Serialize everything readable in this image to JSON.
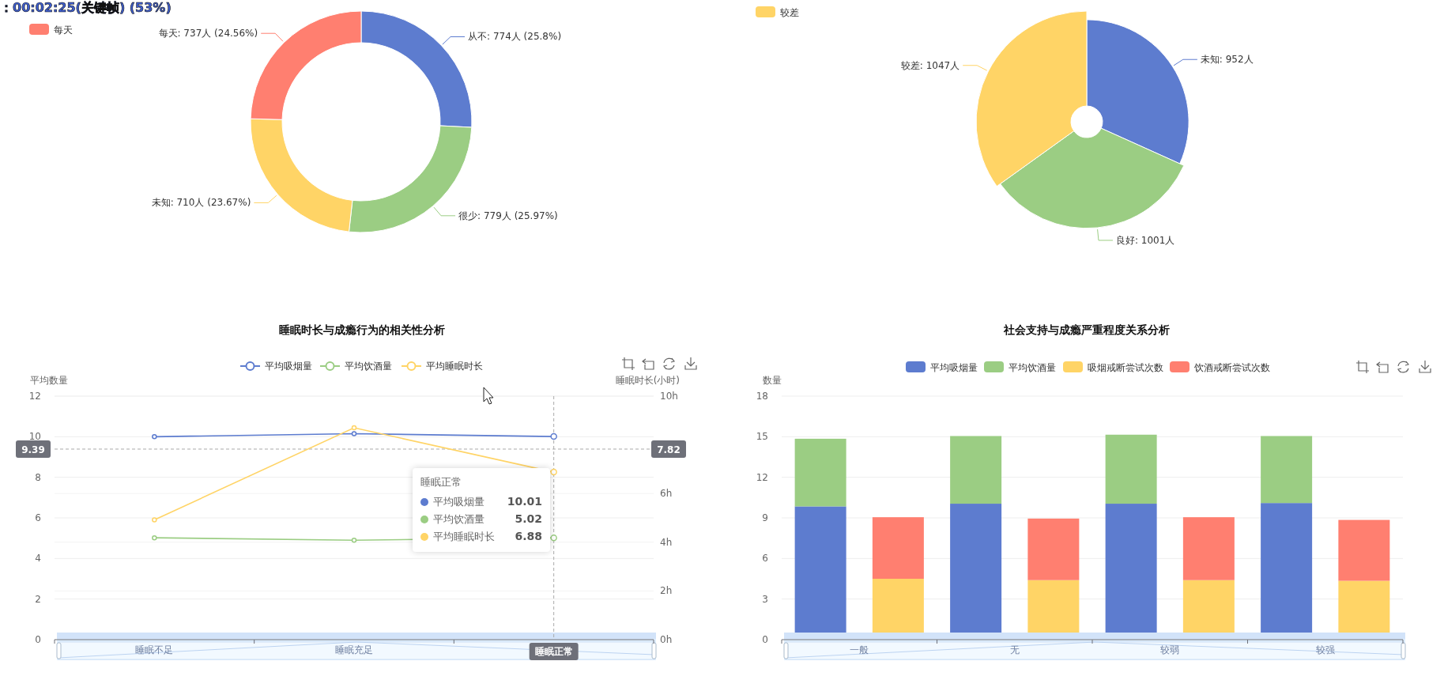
{
  "recorder_overlay": {
    "text": "：00:02:25(关键帧) (53%)"
  },
  "frequency_chart": {
    "legend": [
      {
        "label": "每天",
        "color": "#ff7f70"
      }
    ],
    "chart_data": {
      "type": "donut",
      "categories": [
        "从不: 774人 (25.8%)",
        "很少: 779人 (25.97%)",
        "未知: 710人 (23.67%)",
        "每天: 737人 (24.56%)"
      ],
      "values": [
        774,
        779,
        710,
        737
      ]
    }
  },
  "quality_chart": {
    "legend": [
      {
        "label": "较差",
        "color": "#ffd466"
      }
    ],
    "chart_data": {
      "type": "donut",
      "categories": [
        "未知: 952人",
        "良好: 1001人",
        "较差: 1047人"
      ],
      "values": [
        952,
        1001,
        1047
      ]
    }
  },
  "sleep_chart": {
    "chart_data": {
      "type": "line",
      "title": "睡眠时长与成瘾行为的相关性分析",
      "legend": "top",
      "grid": true,
      "categories": [
        "睡眠不足",
        "睡眠充足",
        "睡眠正常"
      ],
      "series": [
        {
          "name": "平均吸烟量",
          "color": "#5d7ccf",
          "values": [
            10.0,
            10.15,
            10.01
          ],
          "marker": "circle"
        },
        {
          "name": "平均饮酒量",
          "color": "#9bcd83",
          "values": [
            5.02,
            4.9,
            5.02
          ],
          "marker": "circle"
        },
        {
          "name": "平均睡眠时长",
          "color": "#ffd466",
          "values": [
            4.92,
            8.7,
            6.88
          ],
          "axis": "y2",
          "marker": "circle"
        }
      ],
      "ref_lines": [
        {
          "axis": "y",
          "value": 9.39
        },
        {
          "axis": "x",
          "value": "睡眠正常"
        }
      ],
      "ylabel": "平均数量",
      "ylim": [
        0,
        12
      ],
      "yticks": [
        0,
        2,
        4,
        6,
        8,
        10,
        12
      ],
      "y2label": "睡眠时长(小时)",
      "y2lim": [
        0,
        10
      ],
      "y2ticks": [
        {
          "value": 0,
          "label": "0h"
        },
        {
          "value": 2,
          "label": "2h"
        },
        {
          "value": 4,
          "label": "4h"
        },
        {
          "value": 6,
          "label": "6h"
        },
        {
          "value": 10,
          "label": "10h"
        }
      ]
    },
    "tooltip": {
      "title": "睡眠正常",
      "rows": [
        {
          "name": "平均吸烟量",
          "value": "10.01",
          "color": "#5d7ccf"
        },
        {
          "name": "平均饮酒量",
          "value": "5.02",
          "color": "#9bcd83"
        },
        {
          "name": "平均睡眠时长",
          "value": "6.88",
          "color": "#ffd466"
        }
      ]
    },
    "axis_pointer": {
      "y_label": "9.39",
      "y2_label": "7.82"
    }
  },
  "support_chart": {
    "chart_data": {
      "type": "bar",
      "title": "社会支持与成瘾严重程度关系分析",
      "legend": "top",
      "grid": true,
      "ylabel": "数量",
      "categories": [
        "一般",
        null,
        "无",
        null,
        "较弱",
        null,
        "较强",
        null
      ],
      "stacked": true,
      "series": [
        {
          "name": "平均吸烟量",
          "color": "#5d7ccf",
          "values": [
            9.85,
            null,
            10.05,
            null,
            10.05,
            null,
            10.1,
            null
          ]
        },
        {
          "name": "平均饮酒量",
          "color": "#9bcd83",
          "values": [
            5.0,
            null,
            5.0,
            null,
            5.1,
            null,
            4.95,
            null
          ]
        },
        {
          "name": "吸烟戒断尝试次数",
          "color": "#ffd466",
          "values": [
            null,
            4.5,
            null,
            4.4,
            null,
            4.4,
            null,
            4.35
          ]
        },
        {
          "name": "饮酒戒断尝试次数",
          "color": "#ff7f70",
          "values": [
            null,
            4.55,
            null,
            4.55,
            null,
            4.65,
            null,
            4.5
          ]
        }
      ],
      "ylim": [
        0,
        18
      ],
      "yticks": [
        0,
        3,
        6,
        9,
        12,
        15,
        18
      ]
    }
  }
}
